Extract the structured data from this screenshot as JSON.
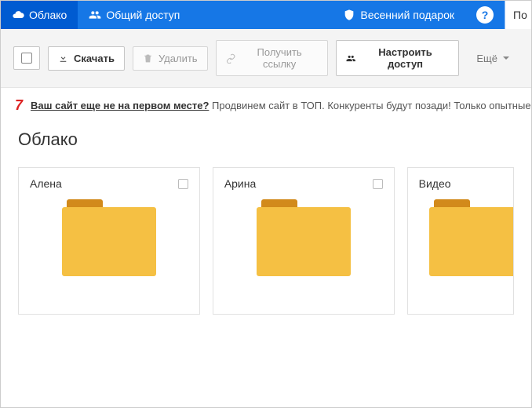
{
  "nav": {
    "cloud": "Облако",
    "shared": "Общий доступ",
    "gift": "Весенний подарок",
    "help": "?",
    "search_fragment": "По"
  },
  "toolbar": {
    "download": "Скачать",
    "delete": "Удалить",
    "get_link": "Получить ссылку",
    "configure_access": "Настроить доступ",
    "more": "Ещё"
  },
  "promo": {
    "badge": "7",
    "link_text": "Ваш сайт еще не на первом месте?",
    "rest": "Продвинем сайт в ТОП. Конкуренты будут позади! Только опытные специали"
  },
  "page": {
    "title": "Облако"
  },
  "folders": [
    {
      "name": "Алена"
    },
    {
      "name": "Арина"
    },
    {
      "name": "Видео"
    }
  ]
}
